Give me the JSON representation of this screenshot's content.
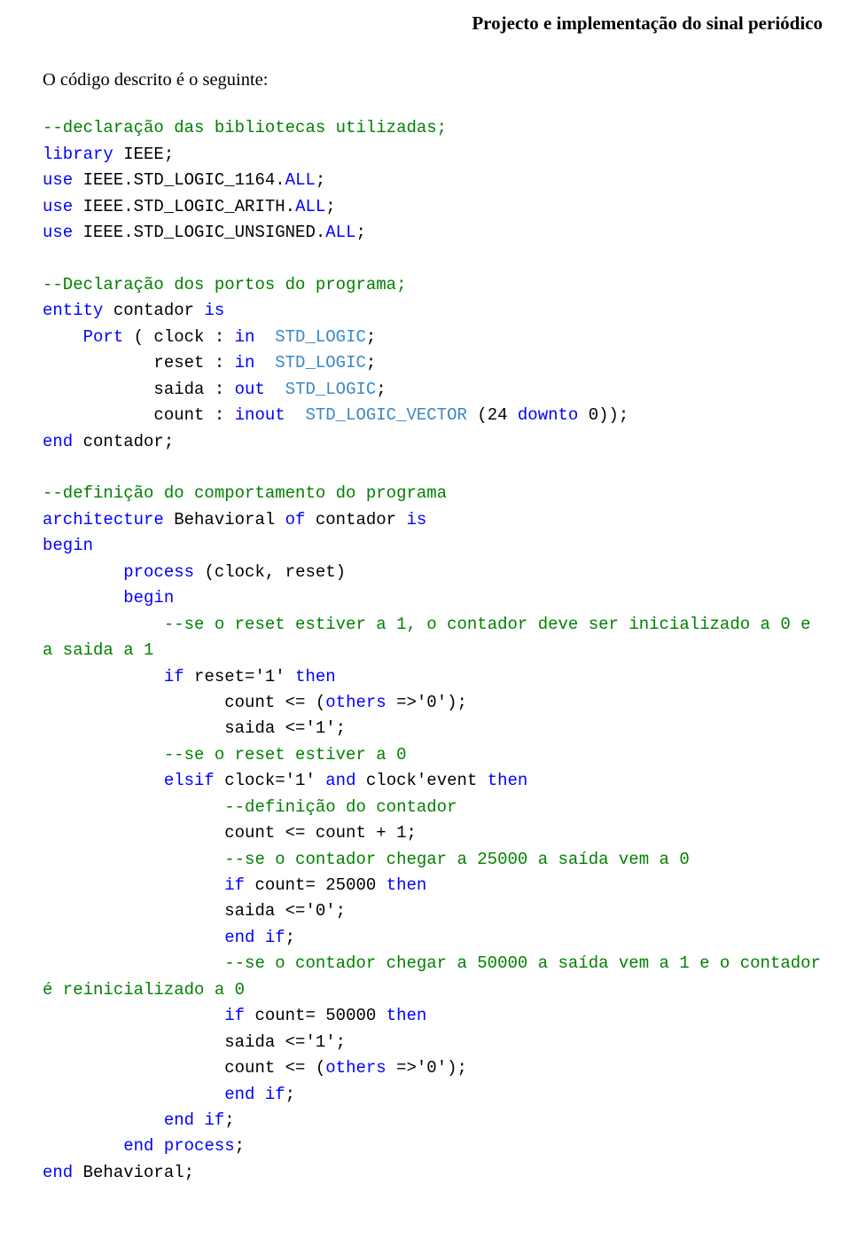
{
  "header": "Projecto e implementação do sinal periódico",
  "intro": "O código descrito é o seguinte:",
  "code": {
    "c0": "--declaração das bibliotecas utilizadas;",
    "l1a": "library",
    "l1b": " IEEE;",
    "l2a": "use",
    "l2b": " IEEE.STD_LOGIC_1164.",
    "l2c": "ALL",
    "l2d": ";",
    "l3a": "use",
    "l3b": " IEEE.STD_LOGIC_ARITH.",
    "l3c": "ALL",
    "l3d": ";",
    "l4a": "use",
    "l4b": " IEEE.STD_LOGIC_UNSIGNED.",
    "l4c": "ALL",
    "l4d": ";",
    "c1": "--Declaração dos portos do programa;",
    "l5a": "entity",
    "l5b": " contador ",
    "l5c": "is",
    "l6a": "    Port",
    "l6b": " ( clock : ",
    "l6c": "in",
    "l6d": "  STD_LOGIC",
    "l6e": ";",
    "l7a": "           reset : ",
    "l7b": "in",
    "l7c": "  STD_LOGIC",
    "l7d": ";",
    "l8a": "           saida : ",
    "l8b": "out",
    "l8c": "  STD_LOGIC",
    "l8d": ";",
    "l9a": "           count : ",
    "l9b": "inout",
    "l9c": "  STD_LOGIC_VECTOR",
    "l9d": " (24 ",
    "l9e": "downto",
    "l9f": " 0));",
    "l10a": "end",
    "l10b": " contador;",
    "c2": "--definição do comportamento do programa",
    "l11a": "architecture",
    "l11b": " Behavioral ",
    "l11c": "of",
    "l11d": " contador ",
    "l11e": "is",
    "l12": "begin",
    "l13a": "        process",
    "l13b": " (clock, reset)",
    "l14": "        begin",
    "c3": "            --se o reset estiver a 1, o contador deve ser inicializado a 0 e a saida a 1",
    "l15a": "            if",
    "l15b": " reset='1' ",
    "l15c": "then",
    "l16a": "                  count <= (",
    "l16b": "others",
    "l16c": " =>'0');",
    "l17": "                  saida <='1';",
    "c4": "            --se o reset estiver a 0",
    "l18a": "            elsif",
    "l18b": " clock='1' ",
    "l18c": "and",
    "l18d": " clock'event ",
    "l18e": "then",
    "c5": "                  --definição do contador",
    "l19": "                  count <= count + 1;",
    "c6": "                  --se o contador chegar a 25000 a saída vem a 0",
    "l20a": "                  if",
    "l20b": " count= 25000 ",
    "l20c": "then",
    "l21": "                  saida <='0';",
    "l22a": "                  end",
    "l22b": " ",
    "l22c": "if",
    "l22d": ";",
    "c7": "                  --se o contador chegar a 50000 a saída vem a 1 e o contador é reinicializado a 0",
    "l23a": "                  if",
    "l23b": " count= 50000 ",
    "l23c": "then",
    "l24": "                  saida <='1';",
    "l25a": "                  count <= (",
    "l25b": "others",
    "l25c": " =>'0');",
    "l26a": "                  end",
    "l26b": " ",
    "l26c": "if",
    "l26d": ";",
    "l27a": "            end",
    "l27b": " ",
    "l27c": "if",
    "l27d": ";",
    "l28a": "        end",
    "l28b": " ",
    "l28c": "process",
    "l28d": ";",
    "l29a": "end",
    "l29b": " Behavioral;"
  }
}
